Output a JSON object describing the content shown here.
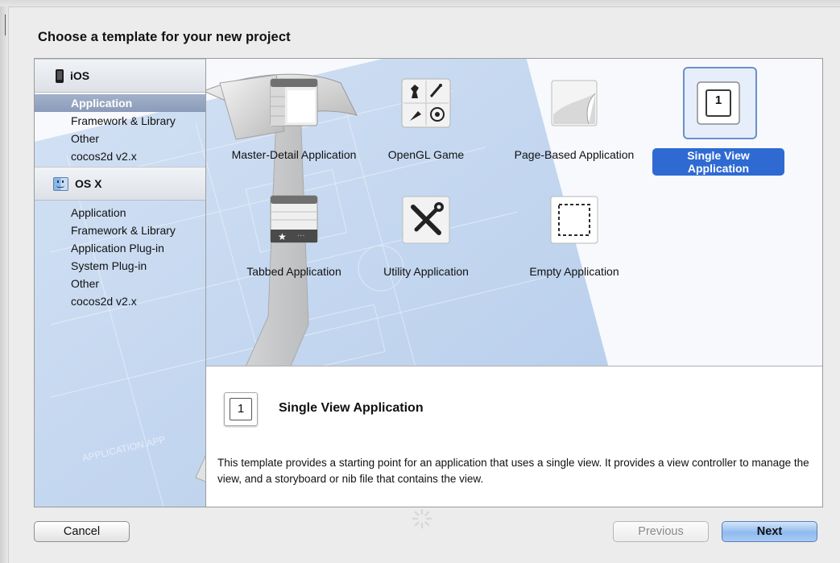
{
  "dialog": {
    "title": "Choose a template for your new project"
  },
  "sidebar": {
    "sections": [
      {
        "label": "iOS",
        "icon": "iphone-icon",
        "items": [
          "Application",
          "Framework & Library",
          "Other",
          "cocos2d v2.x"
        ]
      },
      {
        "label": "OS X",
        "icon": "finder-icon",
        "items": [
          "Application",
          "Framework & Library",
          "Application Plug-in",
          "System Plug-in",
          "Other",
          "cocos2d v2.x"
        ]
      }
    ],
    "selected": "iOS/Application"
  },
  "templates": [
    {
      "label": "Master-Detail Application",
      "icon": "master-detail-icon"
    },
    {
      "label": "OpenGL Game",
      "icon": "opengl-game-icon"
    },
    {
      "label": "Page-Based Application",
      "icon": "page-based-icon"
    },
    {
      "label": "Single View Application",
      "icon": "single-view-icon",
      "icon_text": "1",
      "selected": true
    },
    {
      "label": "Tabbed Application",
      "icon": "tabbed-icon"
    },
    {
      "label": "Utility Application",
      "icon": "utility-icon"
    },
    {
      "label": "Empty Application",
      "icon": "empty-icon"
    }
  ],
  "description": {
    "icon_text": "1",
    "title": "Single View Application",
    "text": "This template provides a starting point for an application that uses a single view. It provides a view controller to manage the view, and a storyboard or nib file that contains the view."
  },
  "buttons": {
    "cancel": "Cancel",
    "previous": "Previous",
    "next": "Next"
  },
  "colors": {
    "selection_blue": "#2f6ad3",
    "sidebar_selection": "#8a9bb9",
    "next_button": "#8fbaf0"
  }
}
